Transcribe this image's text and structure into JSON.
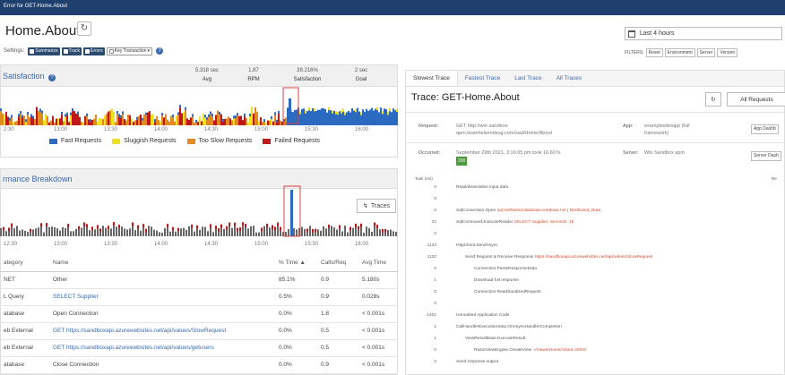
{
  "app": {
    "window_title": "Error for GET-Home.About",
    "page_title": "Home.About",
    "settings_label": "Settings:"
  },
  "toggles": [
    {
      "label": "Summarize",
      "on": true
    },
    {
      "label": "Track",
      "on": true
    },
    {
      "label": "Errors",
      "on": true
    },
    {
      "label": "Key Transaction",
      "on": false
    }
  ],
  "time_picker": {
    "label": "Last 4 hours"
  },
  "filters": {
    "label": "FILTERS:",
    "chips": [
      "Reset",
      "Environment",
      "Server",
      "Version"
    ]
  },
  "satisfaction": {
    "title": "Satisfaction",
    "stats": [
      {
        "value": "5.318 sec",
        "label": "Avg"
      },
      {
        "value": "1.87",
        "label": "RPM"
      },
      {
        "value": "39.216%",
        "label": "Satisfaction"
      },
      {
        "value": "2 sec",
        "label": "Goal"
      }
    ],
    "x_ticks": [
      "2:30",
      "13:00",
      "13:30",
      "14:00",
      "14:30",
      "15:00",
      "15:30",
      "16:00"
    ],
    "legend": [
      {
        "label": "Fast Requests",
        "color": "#2a6ac0"
      },
      {
        "label": "Sluggish Requests",
        "color": "#f0e020"
      },
      {
        "label": "Too Slow Requests",
        "color": "#e08a20"
      },
      {
        "label": "Failed Requests",
        "color": "#c01818"
      }
    ]
  },
  "performance": {
    "title": "rmance Breakdown",
    "traces_label": "Traces",
    "x_ticks": [
      "12:30",
      "13:00",
      "13:30",
      "14:00",
      "14:30",
      "15:00",
      "15:30",
      "16:00"
    ],
    "table": {
      "columns": [
        "ategory",
        "Name",
        "% Time",
        "Calls/Req",
        "Avg Time"
      ],
      "rows": [
        [
          "NET",
          "Other",
          "85.1%",
          "0.9",
          "5.180s"
        ],
        [
          "L Query",
          "SELECT Supplier",
          "0.5%",
          "0.9",
          "0.028s"
        ],
        [
          "atabase",
          "Open Connection",
          "0.0%",
          "1.8",
          "< 0.001s"
        ],
        [
          "eb External",
          "GET https://sandboxapi.azurewebsites.net/api/values/SlowRequest",
          "0.0%",
          "0.5",
          "< 0.001s"
        ],
        [
          "eb External",
          "GET https://sandboxapi.azurewebsites.net/api/values/getusers",
          "0.0%",
          "0.5",
          "< 0.001s"
        ],
        [
          "atabase",
          "Close Connection",
          "0.0%",
          "0.9",
          "< 0.001s"
        ]
      ]
    }
  },
  "trace_panel": {
    "tabs": [
      "Slowest Trace",
      "Fastest Trace",
      "Last Trace",
      "All Traces"
    ],
    "title": "Trace: GET-Home.About",
    "all_requests_label": "All Requests",
    "request_key": "Request:",
    "request_value": "GET http://win-sandbox-apm.teamhelsendsug.com/sad/Home/About",
    "app_key": "App:",
    "app_value": "examplesitetapp (full framework)",
    "app_button": "App Dashb",
    "occurred_key": "Occurred:",
    "occurred_value": "September 29th 2021, 3:16:05 pm took 16.607s",
    "occurred_badge": "200",
    "server_key": "Server:",
    "server_value": "Win Sandbox apm",
    "server_button": "Server Dash",
    "col_took": "Took (ms)",
    "col_re": "Re",
    "tree": [
      {
        "t": "0",
        "indent": 0,
        "text": "Read/deserialize input data",
        "link": ""
      },
      {
        "t": "0",
        "indent": 0,
        "text": "",
        "link": ""
      },
      {
        "t": "0",
        "indent": 0,
        "text": "SqlConnection.Open",
        "link": "sql.northwind.database.windows.net | Northwind_Data"
      },
      {
        "t": "32",
        "indent": 0,
        "text": "SqlCommand.ExecuteReader",
        "link": "SELECT Supplier, Seconds: 16"
      },
      {
        "t": "0",
        "indent": 0,
        "text": "",
        "link": ""
      },
      {
        "t": "1133",
        "indent": 0,
        "text": "HttpClient.SendAsync",
        "link": ""
      },
      {
        "t": "1132",
        "indent": 1,
        "text": "Send Request & Receive Response",
        "link": "https://sandboxapi.azurewebsites.net/api/values/SlowRequest"
      },
      {
        "t": "0",
        "indent": 2,
        "text": "Connection.ParseResponseData",
        "link": ""
      },
      {
        "t": "1",
        "indent": 2,
        "text": "Download full response",
        "link": ""
      },
      {
        "t": "0",
        "indent": 2,
        "text": "Connection.ReadSanitizedRequest",
        "link": ""
      },
      {
        "t": "0",
        "indent": 0,
        "text": "",
        "link": ""
      },
      {
        "t": "1401",
        "indent": 0,
        "text": "Unmarked Application Code",
        "link": ""
      },
      {
        "t": "1",
        "indent": 0,
        "text": "CallHandlerExecutionStep.OnAsyncHandlerCompletion",
        "link": ""
      },
      {
        "t": "1",
        "indent": 1,
        "text": "ViewResultBase.ExecuteResult",
        "link": ""
      },
      {
        "t": "0",
        "indent": 2,
        "text": "RazorViewEngine.CreateView",
        "link": "~/Views/Home/About.cshtml"
      },
      {
        "t": "0",
        "indent": 0,
        "text": "Send response output",
        "link": ""
      }
    ]
  }
}
